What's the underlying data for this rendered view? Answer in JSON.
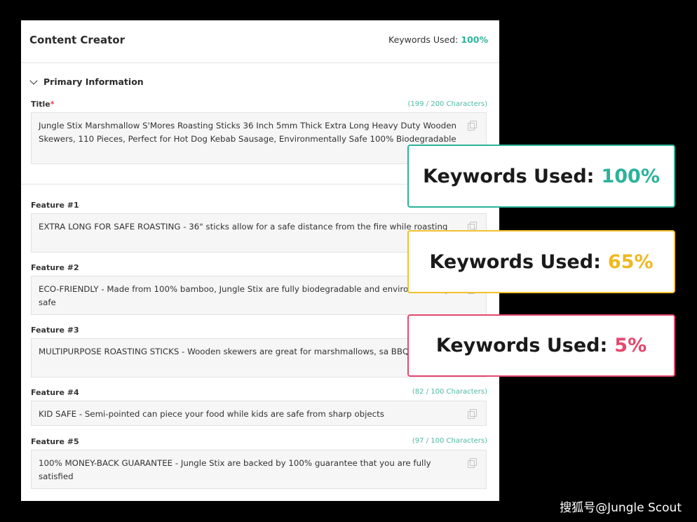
{
  "header": {
    "title": "Content Creator",
    "keywords_label": "Keywords Used:",
    "keywords_value": "100%"
  },
  "section": {
    "label": "Primary Information"
  },
  "title_field": {
    "label": "Title",
    "required_mark": "*",
    "count": "(199 / 200 Characters)",
    "value": "Jungle Stix Marshmallow S'Mores Roasting Sticks 36 Inch 5mm Thick Extra Long Heavy Duty Wooden Skewers, 110 Pieces, Perfect for Hot Dog Kebab Sausage, Environmentally Safe 100% Biodegradable"
  },
  "features": [
    {
      "label": "Feature #1",
      "count": "",
      "value": "EXTRA LONG FOR SAFE ROASTING - 36\" sticks allow for a safe distance from the fire while roasting"
    },
    {
      "label": "Feature #2",
      "count": "",
      "value": "ECO-FRIENDLY - Made from 100% bamboo, Jungle Stix are fully biodegradable and environmentally safe"
    },
    {
      "label": "Feature #3",
      "count": "",
      "value": "MULTIPURPOSE ROASTING STICKS - Wooden skewers are great for marshmallows, sa BBQ, hot dogs"
    },
    {
      "label": "Feature #4",
      "count": "(82 / 100 Characters)",
      "value": "KID SAFE - Semi-pointed can piece your food while kids are safe from sharp objects"
    },
    {
      "label": "Feature #5",
      "count": "(97 / 100 Characters)",
      "value": "100% MONEY-BACK GUARANTEE - Jungle Stix are backed by 100% guarantee that you are fully satisfied"
    }
  ],
  "cards": [
    {
      "label": "Keywords Used:",
      "value": "100%",
      "color": "#2bb39a"
    },
    {
      "label": "Keywords Used:",
      "value": "65%",
      "color": "#efb81f"
    },
    {
      "label": "Keywords Used:",
      "value": "5%",
      "color": "#e5486d"
    }
  ],
  "watermark": "搜狐号@Jungle Scout",
  "icons": {
    "copy": "copy-icon",
    "chevron": "chevron-down-icon"
  }
}
